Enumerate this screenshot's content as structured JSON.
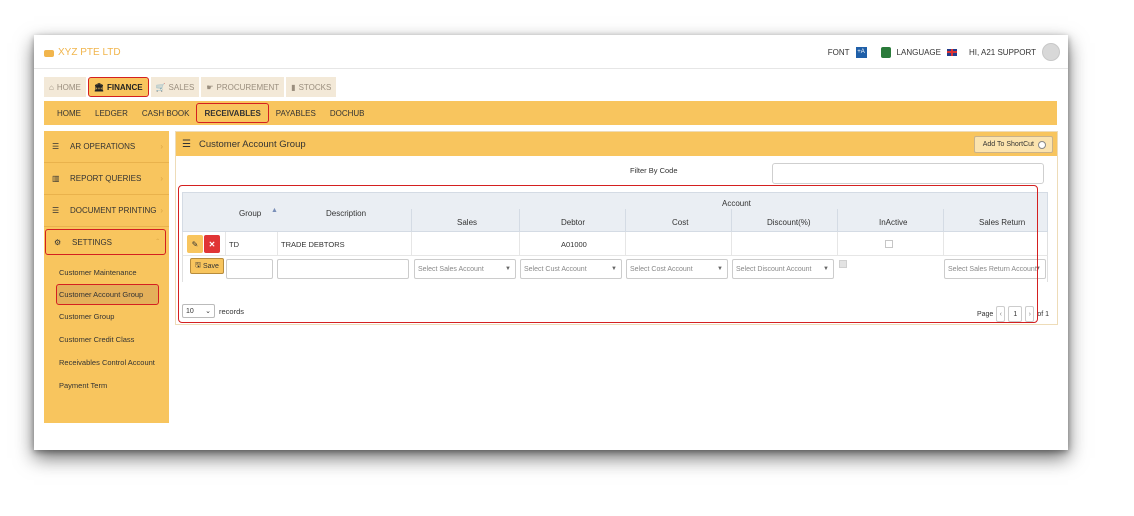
{
  "brand": {
    "name": "XYZ PTE LTD"
  },
  "topbar": {
    "font_label": "FONT",
    "font_icon_text": "+A",
    "language_label": "LANGUAGE",
    "greeting": "HI, A21 SUPPORT"
  },
  "module_tabs": [
    {
      "label": "HOME",
      "icon": "home-icon"
    },
    {
      "label": "FINANCE",
      "icon": "bank-icon",
      "active": true
    },
    {
      "label": "SALES",
      "icon": "cart-icon"
    },
    {
      "label": "PROCUREMENT",
      "icon": "procurement-icon"
    },
    {
      "label": "STOCKS",
      "icon": "chart-icon"
    }
  ],
  "submenu": [
    {
      "label": "HOME"
    },
    {
      "label": "LEDGER"
    },
    {
      "label": "CASH BOOK"
    },
    {
      "label": "RECEIVABLES",
      "active": true
    },
    {
      "label": "PAYABLES"
    },
    {
      "label": "DOCHUB"
    }
  ],
  "sidebar": {
    "sections": [
      {
        "label": "AR OPERATIONS",
        "icon": "list-icon"
      },
      {
        "label": "REPORT QUERIES",
        "icon": "bar-chart-icon"
      },
      {
        "label": "DOCUMENT PRINTING",
        "icon": "list-icon"
      },
      {
        "label": "SETTINGS",
        "icon": "gears-icon",
        "active": true
      }
    ],
    "settings_items": [
      {
        "label": "Customer Maintenance"
      },
      {
        "label": "Customer Account Group",
        "active": true
      },
      {
        "label": "Customer Group"
      },
      {
        "label": "Customer Credit Class"
      },
      {
        "label": "Receivables Control Account"
      },
      {
        "label": "Payment Term"
      }
    ]
  },
  "panel": {
    "title": "Customer Account Group",
    "shortcut_label": "Add To ShortCut",
    "filter_label": "Filter By Code",
    "table": {
      "group_header": "Account",
      "columns": [
        "Group",
        "Description",
        "Sales",
        "Debtor",
        "Cost",
        "Discount(%)",
        "InActive",
        "Sales Return"
      ],
      "rows": [
        {
          "group": "TD",
          "description": "TRADE DEBTORS",
          "sales": "",
          "debtor": "A01000",
          "cost": "",
          "discount": "",
          "inactive": false,
          "sales_return": ""
        }
      ],
      "new_row": {
        "save_label": "Save",
        "sales_placeholder": "Select Sales Account",
        "debtor_placeholder": "Select Cust Account",
        "cost_placeholder": "Select Cost Account",
        "discount_placeholder": "Select Discount Account",
        "sales_return_placeholder": "Select Sales Return Account"
      }
    },
    "pager": {
      "page_size": "10",
      "records_label": "records",
      "page_label": "Page",
      "current_page": "1",
      "of_label": "of 1"
    }
  }
}
